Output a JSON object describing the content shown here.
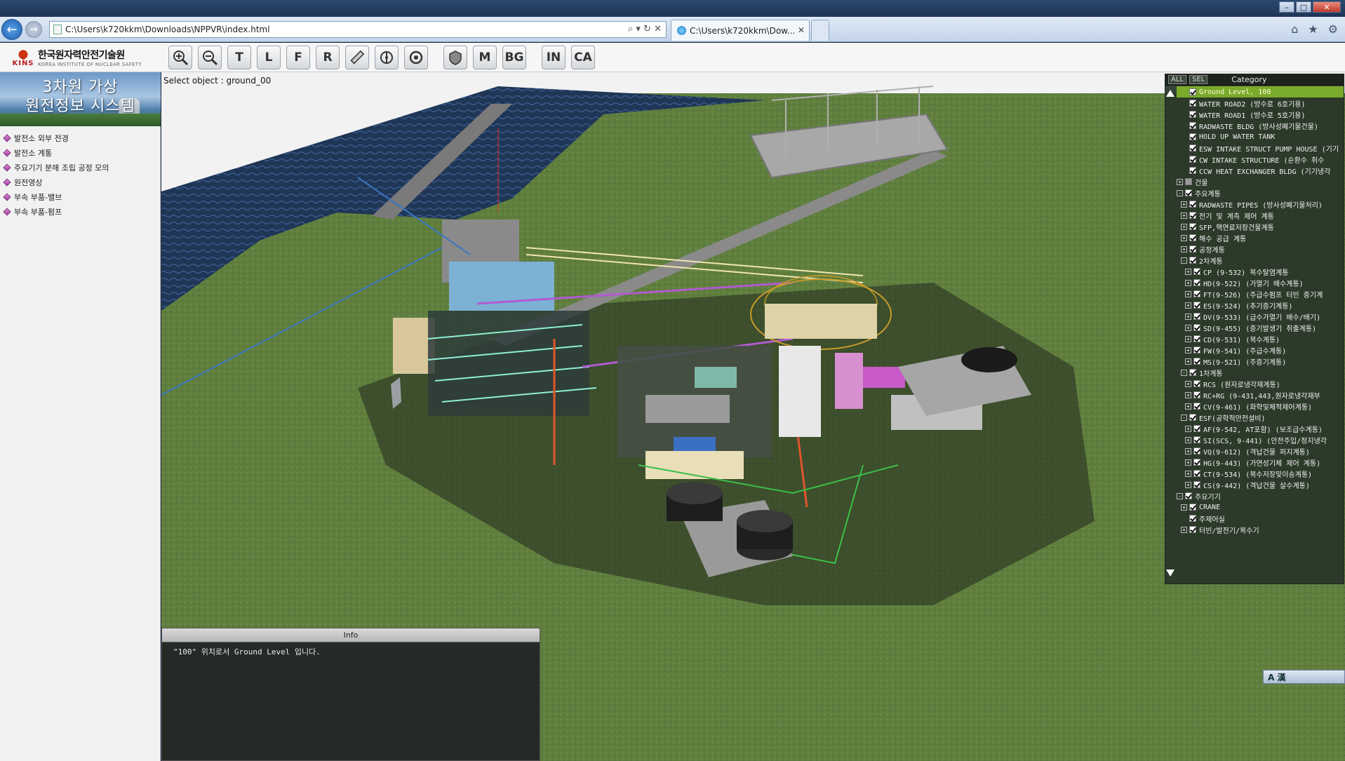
{
  "browser": {
    "address": "C:\\Users\\k720kkm\\Downloads\\NPPVR\\index.html",
    "tab_title": "C:\\Users\\k720kkm\\Dow...",
    "addr_icons": "⌕ ▾ ↻ ✕",
    "tab_close": "✕",
    "back_glyph": "←",
    "fwd_glyph": "→",
    "home_glyph": "⌂",
    "fav_glyph": "★",
    "gear_glyph": "⚙",
    "win_min": "–",
    "win_max": "□",
    "win_close": "✕"
  },
  "logo": {
    "korean": "한국원자력안전기술원",
    "english": "KOREA INSTITUTE OF NUCLEAR SAFETY",
    "abbr": "KINS"
  },
  "toolbar": {
    "tools": [
      {
        "name": "zoom-in",
        "glyph": ""
      },
      {
        "name": "zoom-out",
        "glyph": ""
      },
      {
        "name": "top-view",
        "glyph": "T"
      },
      {
        "name": "left-view",
        "glyph": "L"
      },
      {
        "name": "front-view",
        "glyph": "F"
      },
      {
        "name": "right-view",
        "glyph": "R"
      },
      {
        "name": "measure",
        "glyph": ""
      },
      {
        "name": "section",
        "glyph": ""
      },
      {
        "name": "reset",
        "glyph": ""
      },
      {
        "name": "shield",
        "glyph": ""
      },
      {
        "name": "material",
        "glyph": "M"
      },
      {
        "name": "background",
        "glyph": "BG"
      },
      {
        "name": "inside",
        "glyph": "IN"
      },
      {
        "name": "camera",
        "glyph": "CA"
      }
    ]
  },
  "sidebar": {
    "banner_line1": "3차원 가상",
    "banner_line2": "원전정보 시스템",
    "items": [
      {
        "label": "발전소 외부 전경"
      },
      {
        "label": "발전소 계통"
      },
      {
        "label": "주요기기 분해 조립 공정 모의"
      },
      {
        "label": "원전영상"
      },
      {
        "label": "부속 부품-밸브"
      },
      {
        "label": "부속 부품-펌프"
      }
    ]
  },
  "viewport": {
    "select_label": "Select object : ground_00"
  },
  "info": {
    "title": "Info",
    "text": "\"100\" 위치로서 Ground Level 입니다."
  },
  "category": {
    "btn_all": "ALL",
    "btn_sel": "SEL",
    "title": "Category",
    "rows": [
      {
        "label": "Ground Level, 100",
        "indent": 1,
        "expander": "",
        "checked": true,
        "selected": true
      },
      {
        "label": "WATER ROAD2 (방수로 6호기용)",
        "indent": 1,
        "expander": "",
        "checked": true
      },
      {
        "label": "WATER ROAD1 (방수로 5호기용)",
        "indent": 1,
        "expander": "",
        "checked": true
      },
      {
        "label": "RADWASTE BLDG (방사성폐기물건물)",
        "indent": 1,
        "expander": "",
        "checked": true
      },
      {
        "label": "HOLD UP WATER TANK",
        "indent": 1,
        "expander": "",
        "checked": true
      },
      {
        "label": "ESW INTAKE STRUCT PUMP HOUSE (기기",
        "indent": 1,
        "expander": "",
        "checked": true
      },
      {
        "label": "CW INTAKE STRUCTURE (순환수 취수",
        "indent": 1,
        "expander": "",
        "checked": true
      },
      {
        "label": "CCW HEAT EXCHANGER BLDG (기기냉각",
        "indent": 1,
        "expander": "",
        "checked": true
      },
      {
        "label": "건물",
        "indent": 0,
        "expander": "+",
        "checked": false,
        "partial": true
      },
      {
        "label": "주요계통",
        "indent": 0,
        "expander": "-",
        "checked": true
      },
      {
        "label": "RADWASTE PIPES (방사성폐기물처리)",
        "indent": 1,
        "expander": "+",
        "checked": true
      },
      {
        "label": "전기 및 계측 제어 계통",
        "indent": 1,
        "expander": "+",
        "checked": true
      },
      {
        "label": "SFP,핵연료저장건물계통",
        "indent": 1,
        "expander": "+",
        "checked": true
      },
      {
        "label": "해수 공급 계통",
        "indent": 1,
        "expander": "+",
        "checked": true
      },
      {
        "label": "공정계통",
        "indent": 1,
        "expander": "+",
        "checked": true
      },
      {
        "label": "2차계통",
        "indent": 1,
        "expander": "-",
        "checked": true
      },
      {
        "label": "CP (9-532) 복수탈염계통",
        "indent": 2,
        "expander": "+",
        "checked": true
      },
      {
        "label": "HD(9-522) (가열기 배수계통)",
        "indent": 2,
        "expander": "+",
        "checked": true
      },
      {
        "label": "FT(9-526) (주급수펌프 터빈 증기계",
        "indent": 2,
        "expander": "+",
        "checked": true
      },
      {
        "label": "ES(9-524) (추기증기계통)",
        "indent": 2,
        "expander": "+",
        "checked": true
      },
      {
        "label": "DV(9-533) (급수가열기 배수/배기)",
        "indent": 2,
        "expander": "+",
        "checked": true
      },
      {
        "label": "SD(9-455) (증기발생기 취출계통)",
        "indent": 2,
        "expander": "+",
        "checked": true
      },
      {
        "label": "CD(9-531) (복수계통)",
        "indent": 2,
        "expander": "+",
        "checked": true
      },
      {
        "label": "FW(9-541) (주급수계통)",
        "indent": 2,
        "expander": "+",
        "checked": true
      },
      {
        "label": "MS(9-521) (주증기계통)",
        "indent": 2,
        "expander": "+",
        "checked": true
      },
      {
        "label": "1차계통",
        "indent": 1,
        "expander": "-",
        "checked": true
      },
      {
        "label": "RCS (원자로냉각재계통)",
        "indent": 2,
        "expander": "+",
        "checked": true
      },
      {
        "label": "RC+RG (9-431,443,원자로냉각재부",
        "indent": 2,
        "expander": "+",
        "checked": true
      },
      {
        "label": "CV(9-461) (화학및체적제어계통)",
        "indent": 2,
        "expander": "+",
        "checked": true
      },
      {
        "label": "ESF(공학적안전설비)",
        "indent": 1,
        "expander": "-",
        "checked": true
      },
      {
        "label": "AF(9-542, AT포함) (보조급수계통)",
        "indent": 2,
        "expander": "+",
        "checked": true
      },
      {
        "label": "SI(SCS, 9-441) (안전주입/정지냉각",
        "indent": 2,
        "expander": "+",
        "checked": true
      },
      {
        "label": "VQ(9-612) (격납건물 퍼지계통)",
        "indent": 2,
        "expander": "+",
        "checked": true
      },
      {
        "label": "HG(9-443) (가연성기체 제어 계통)",
        "indent": 2,
        "expander": "+",
        "checked": true
      },
      {
        "label": "CT(9-534) (복수저장및이송계통)",
        "indent": 2,
        "expander": "+",
        "checked": true
      },
      {
        "label": "CS(9-442) (격납건물 살수계통)",
        "indent": 2,
        "expander": "+",
        "checked": true
      },
      {
        "label": "주요기기",
        "indent": 0,
        "expander": "-",
        "checked": true
      },
      {
        "label": "CRANE",
        "indent": 1,
        "expander": "+",
        "checked": true
      },
      {
        "label": "주제어실",
        "indent": 1,
        "expander": "",
        "checked": true
      },
      {
        "label": "터빈/발전기/복수기",
        "indent": 1,
        "expander": "+",
        "checked": true
      }
    ]
  },
  "ime": {
    "text": "A 漢"
  },
  "colors": {
    "ground": "#5f7d3c",
    "water": "#203a5a",
    "selected_row": "#7aaa2a"
  }
}
